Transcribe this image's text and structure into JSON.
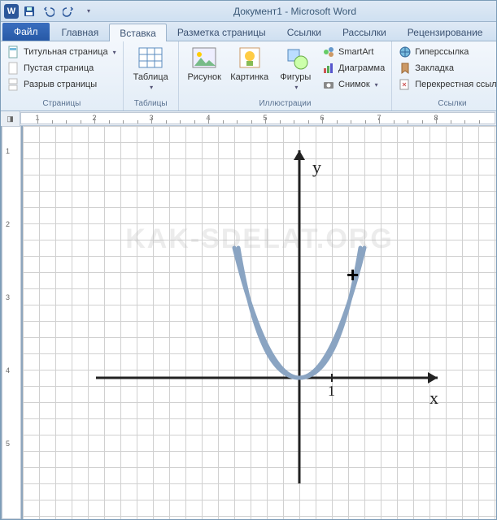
{
  "title": "Документ1 - Microsoft Word",
  "file_tab": "Файл",
  "tabs": [
    "Главная",
    "Вставка",
    "Разметка страницы",
    "Ссылки",
    "Рассылки",
    "Рецензирование"
  ],
  "active_tab_index": 1,
  "ribbon": {
    "pages": {
      "label": "Страницы",
      "cover": "Титульная страница",
      "blank": "Пустая страница",
      "break": "Разрыв страницы"
    },
    "tables": {
      "label": "Таблицы",
      "btn": "Таблица"
    },
    "illustrations": {
      "label": "Иллюстрации",
      "picture": "Рисунок",
      "clipart": "Картинка",
      "shapes": "Фигуры",
      "smartart": "SmartArt",
      "chart": "Диаграмма",
      "screenshot": "Снимок"
    },
    "links": {
      "label": "Ссылки",
      "hyperlink": "Гиперссылка",
      "bookmark": "Закладка",
      "crossref": "Перекрестная ссылка"
    }
  },
  "ruler": {
    "h_numbers": [
      1,
      2,
      3,
      4,
      5,
      6,
      7,
      8
    ],
    "v_numbers": [
      1,
      2,
      3,
      4,
      5
    ]
  },
  "watermark": "KAK-SDELAT.ORG",
  "chart_data": {
    "type": "line",
    "title": "",
    "xlabel": "x",
    "ylabel": "y",
    "x_ticks": [
      1
    ],
    "y_ticks": [],
    "origin": [
      0,
      0
    ],
    "series": [
      {
        "name": "parabola",
        "x": [
          -2,
          -1.5,
          -1,
          -0.5,
          0,
          0.5,
          1,
          1.5,
          2
        ],
        "y": [
          4,
          2.25,
          1,
          0.25,
          0,
          0.25,
          1,
          2.25,
          4
        ]
      }
    ],
    "xlim": [
      -5,
      5
    ],
    "ylim": [
      -3,
      7
    ]
  }
}
